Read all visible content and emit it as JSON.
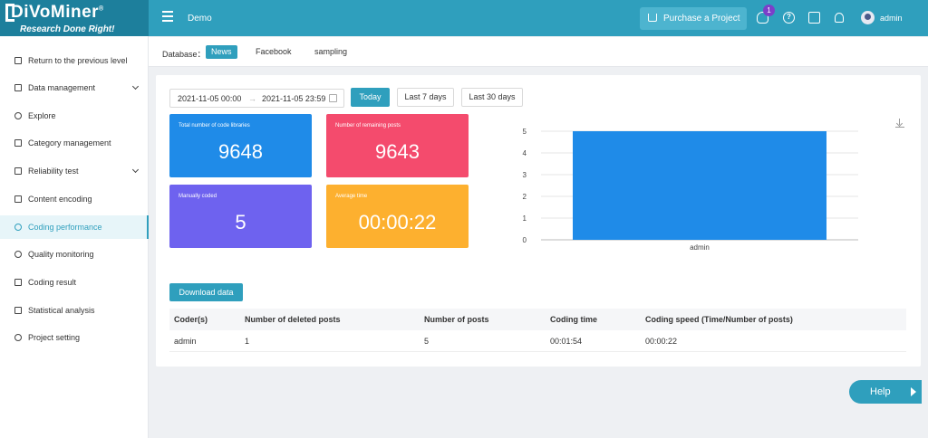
{
  "app": {
    "logo_title": "DiVoMiner",
    "logo_reg": "®",
    "logo_tagline": "Research Done Right!",
    "project_name": "Demo",
    "purchase_label": "Purchase a Project",
    "notification_count": "1",
    "user_name": "admin",
    "accent_color": "#2f9fbd"
  },
  "sidebar": {
    "items": [
      {
        "label": "Return to the previous level",
        "icon": "return-icon"
      },
      {
        "label": "Data management",
        "icon": "file-icon",
        "expandable": true
      },
      {
        "label": "Explore",
        "icon": "compass-icon"
      },
      {
        "label": "Category management",
        "icon": "page-icon"
      },
      {
        "label": "Reliability test",
        "icon": "checklist-icon",
        "expandable": true
      },
      {
        "label": "Content encoding",
        "icon": "pen-icon"
      },
      {
        "label": "Coding performance",
        "icon": "target-icon",
        "active": true
      },
      {
        "label": "Quality monitoring",
        "icon": "eye-icon"
      },
      {
        "label": "Coding result",
        "icon": "doc-icon"
      },
      {
        "label": "Statistical analysis",
        "icon": "bar-chart-icon"
      },
      {
        "label": "Project setting",
        "icon": "gear-icon"
      }
    ]
  },
  "database": {
    "label": "Database：",
    "tabs": [
      {
        "label": "News",
        "active": true
      },
      {
        "label": "Facebook"
      },
      {
        "label": "sampling"
      }
    ]
  },
  "filters": {
    "start_date": "2021-11-05 00:00",
    "arrow": "→",
    "end_date": "2021-11-05 23:59",
    "buttons": [
      {
        "label": "Today",
        "active": true
      },
      {
        "label": "Last 7 days"
      },
      {
        "label": "Last 30 days"
      }
    ]
  },
  "stats": [
    {
      "label": "Total number of code libraries",
      "value": "9648",
      "color": "#1f8be8"
    },
    {
      "label": "Number of remaining posts",
      "value": "9643",
      "color": "#f44b6d"
    },
    {
      "label": "Manually coded",
      "value": "5",
      "color": "#6e62ef"
    },
    {
      "label": "Average time",
      "value": "00:00:22",
      "color": "#fdb02f"
    }
  ],
  "chart_data": {
    "type": "bar",
    "categories": [
      "admin"
    ],
    "values": [
      5
    ],
    "ylim": [
      0,
      5
    ],
    "yticks": [
      "0",
      "1",
      "2",
      "3",
      "4",
      "5"
    ],
    "grid": true,
    "bar_color": "#1f8be8"
  },
  "download": {
    "label": "Download data"
  },
  "table": {
    "headers": [
      "Coder(s)",
      "Number of deleted posts",
      "Number of posts",
      "Coding time",
      "Coding speed (Time/Number of posts)"
    ],
    "rows": [
      [
        "admin",
        "1",
        "5",
        "00:01:54",
        "00:00:22"
      ]
    ]
  },
  "help": {
    "label": "Help"
  }
}
